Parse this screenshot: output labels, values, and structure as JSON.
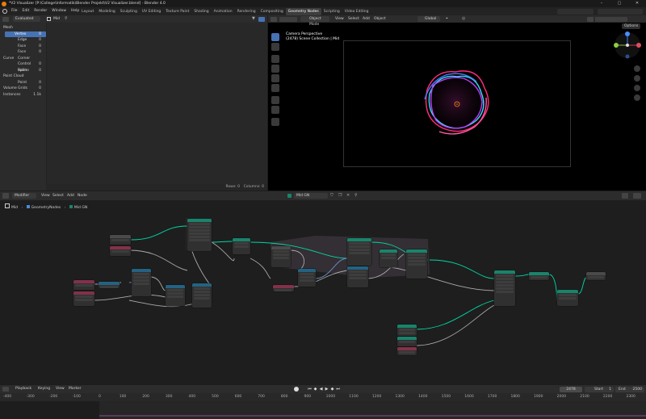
{
  "title_bar": {
    "title": "*V2 Visualizer [P:\\College\\Informatik\\Blender Projekt\\V2 Visualizer.blend] - Blender 4.0"
  },
  "menu": {
    "items": [
      "File",
      "Edit",
      "Render",
      "Window",
      "Help"
    ]
  },
  "workspaces": [
    "Layout",
    "Modeling",
    "Sculpting",
    "UV Editing",
    "Texture Paint",
    "Shading",
    "Animation",
    "Rendering",
    "Compositing",
    "Geometry Nodes",
    "Scripting",
    "Video Editing"
  ],
  "workspace_active": "Geometry Nodes",
  "spreadsheet": {
    "mode": "Evaluated",
    "object": "Mid",
    "tree": [
      {
        "label": "Mesh",
        "count": "",
        "level": 0,
        "selected": false
      },
      {
        "label": "Vertex",
        "count": "0",
        "level": 1,
        "selected": true
      },
      {
        "label": "Edge",
        "count": "0",
        "level": 1,
        "selected": false
      },
      {
        "label": "Face",
        "count": "0",
        "level": 1,
        "selected": false
      },
      {
        "label": "Face Corner",
        "count": "0",
        "level": 1,
        "selected": false
      },
      {
        "label": "Curve",
        "count": "",
        "level": 0,
        "selected": false
      },
      {
        "label": "Control Point",
        "count": "0",
        "level": 1,
        "selected": false
      },
      {
        "label": "Spline",
        "count": "0",
        "level": 1,
        "selected": false
      },
      {
        "label": "Point Cloud",
        "count": "",
        "level": 0,
        "selected": false
      },
      {
        "label": "Point",
        "count": "0",
        "level": 1,
        "selected": false
      },
      {
        "label": "Volume Grids",
        "count": "0",
        "level": 0,
        "selected": false
      },
      {
        "label": "Instances",
        "count": "1.1k",
        "level": 0,
        "selected": false
      }
    ],
    "rows_label": "Rows: 0",
    "columns_label": "Columns: 0"
  },
  "viewport": {
    "mode": "Object Mode",
    "menus": [
      "View",
      "Select",
      "Add",
      "Object"
    ],
    "orientation": "Global",
    "options": "Options",
    "info_line1": "Camera Perspective",
    "info_line2": "(2478) Scene Collection | Mid"
  },
  "node_editor": {
    "editor_type": "Modifier",
    "menus": [
      "View",
      "Select",
      "Add",
      "Node"
    ],
    "tree_name": "Mid GN",
    "breadcrumb": [
      "Mid",
      "GeometryNodes",
      "Mid GN"
    ]
  },
  "timeline": {
    "menus": [
      "Playback",
      "Keying",
      "View",
      "Marker"
    ],
    "current_frame": "2478",
    "start_label": "Start",
    "start": "1",
    "end_label": "End",
    "end": "2500",
    "ticks": [
      "-400",
      "-300",
      "-200",
      "-100",
      "0",
      "100",
      "200",
      "300",
      "400",
      "500",
      "600",
      "700",
      "800",
      "900",
      "1000",
      "1100",
      "1200",
      "1300",
      "1400",
      "1500",
      "1600",
      "1700",
      "1800",
      "1900",
      "2000",
      "2100",
      "2200",
      "2300"
    ]
  },
  "colors": {
    "accent": "#4772b3",
    "geometry_header": "#19846b",
    "input_header": "#83314a",
    "selection_outline": "#e8a33c"
  }
}
